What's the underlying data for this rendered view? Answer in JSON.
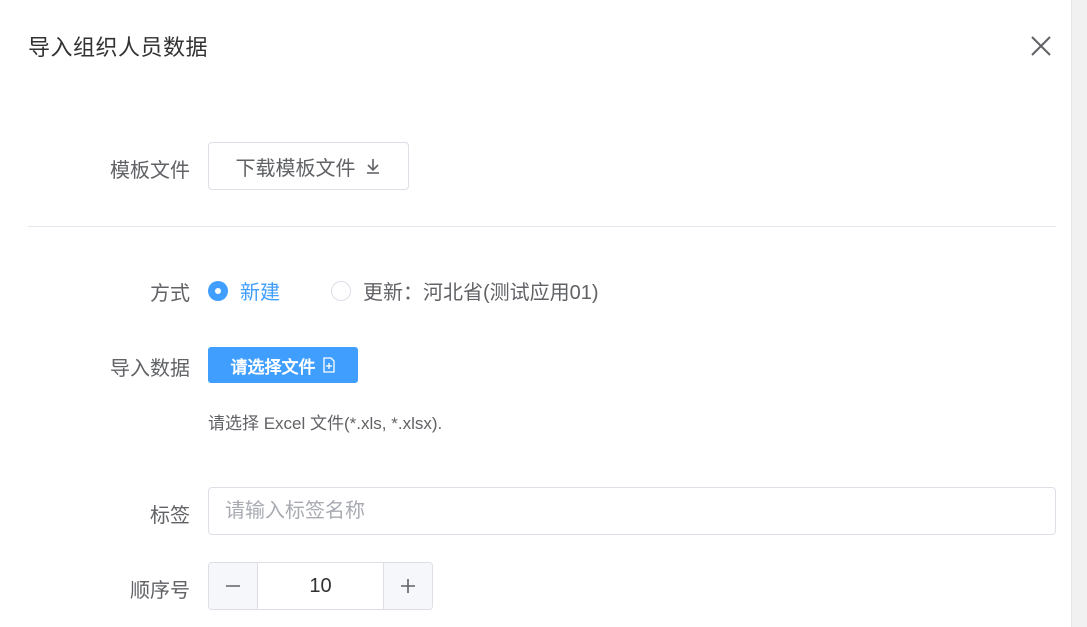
{
  "dialog": {
    "title": "导入组织人员数据",
    "close_icon": "close-icon"
  },
  "template": {
    "label": "模板文件",
    "download_label": "下载模板文件",
    "download_icon": "download-icon"
  },
  "mode": {
    "label": "方式",
    "options": [
      {
        "label": "新建",
        "checked": true
      },
      {
        "label": "更新：河北省(测试应用01)",
        "checked": false
      }
    ]
  },
  "import": {
    "label": "导入数据",
    "button_label": "请选择文件",
    "button_icon": "file-icon",
    "hint": "请选择 Excel 文件(*.xls, *.xlsx)."
  },
  "tag": {
    "label": "标签",
    "placeholder": "请输入标签名称",
    "value": ""
  },
  "order": {
    "label": "顺序号",
    "value": "10"
  },
  "colors": {
    "primary": "#409eff",
    "text": "#606266",
    "border": "#dcdfe6"
  }
}
